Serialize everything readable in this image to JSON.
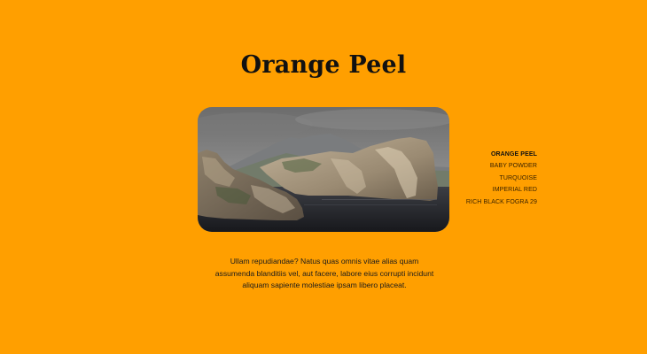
{
  "page": {
    "title": "Orange Peel",
    "background_color": "#FF9F00"
  },
  "nav": {
    "items": [
      {
        "label": "ORANGE PEEL",
        "active": true
      },
      {
        "label": "BABY POWDER",
        "active": false
      },
      {
        "label": "TURQUOISE",
        "active": false
      },
      {
        "label": "IMPERIAL RED",
        "active": false
      },
      {
        "label": "RICH BLACK FOGRA 29",
        "active": false
      }
    ]
  },
  "content": {
    "paragraph": "Ullam repudiandae? Natus quas omnis vitae alias quam assumenda blanditiis vel, aut facere, labore eius corrupti incidunt aliquam sapiente molestiae ipsam libero placeat."
  }
}
